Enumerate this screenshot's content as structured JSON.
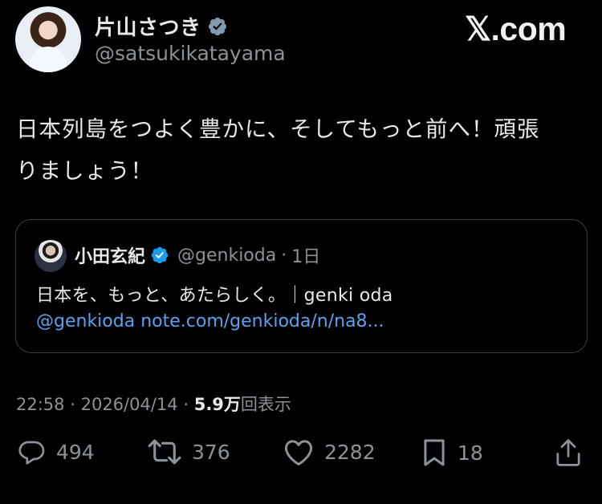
{
  "author": {
    "display_name": "片山さつき",
    "handle": "@satsukikatayama",
    "verified_badge": "grey-verified-icon"
  },
  "brand": {
    "text": "𝕏.com"
  },
  "tweet": {
    "lines": [
      "日本列島をつよく豊かに、そしてもっと前へ！頑張",
      "りましょう！"
    ]
  },
  "quote": {
    "display_name": "小田玄紀",
    "handle": "@genkioda",
    "separator": "·",
    "age": "1日",
    "text": "日本を、もっと、あたらしく。｜genki oda",
    "mention": "@genkioda",
    "link": "note.com/genkioda/n/na8..."
  },
  "meta": {
    "time": "22:58",
    "sep1": "·",
    "date": "2026/04/14",
    "sep2": "·",
    "views_count": "5.9万",
    "views_label": "回表示"
  },
  "actions": {
    "replies": "494",
    "retweets": "376",
    "likes": "2282",
    "bookmarks": "18"
  },
  "colors": {
    "background": "#000000",
    "text": "#e7e9ea",
    "muted": "#8b9299",
    "link": "#5aa2f0",
    "verified_blue": "#1d9bf0",
    "verified_grey": "#829aab"
  }
}
